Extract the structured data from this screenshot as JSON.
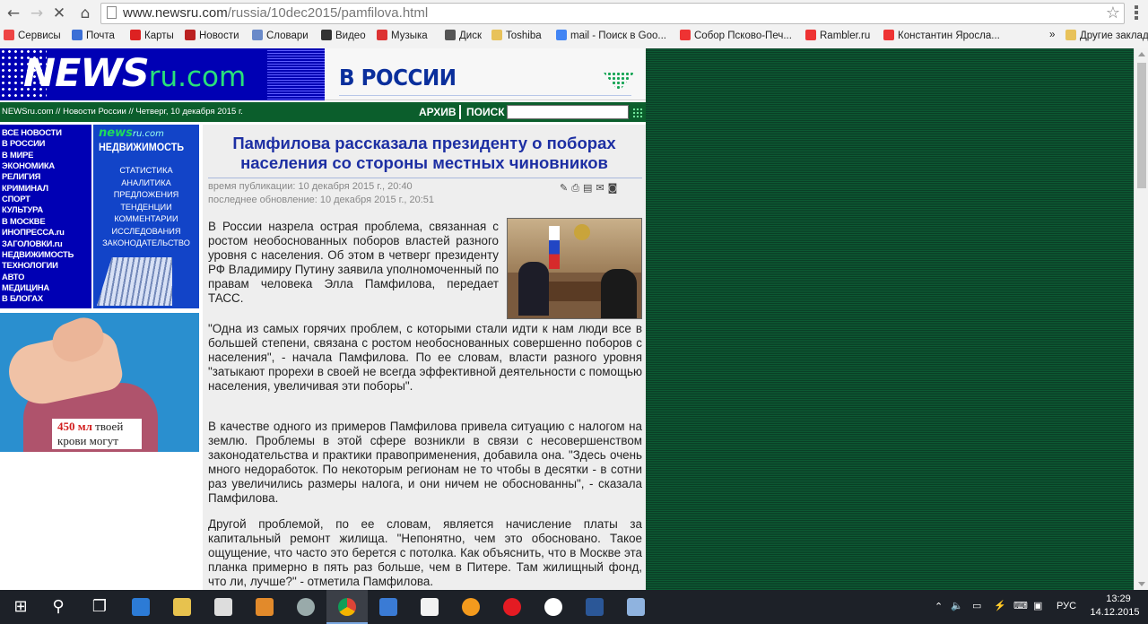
{
  "browser": {
    "url_host": "www.newsru.com",
    "url_path": "/russia/10dec2015/pamfilova.html",
    "bookmarks": [
      {
        "label": "Сервисы",
        "icon": "apps-icon",
        "color": "#e44"
      },
      {
        "label": "Почта",
        "icon": "mail-icon",
        "color": "#3b6fd6"
      },
      {
        "label": "Карты",
        "icon": "map-pin-icon",
        "color": "#d22"
      },
      {
        "label": "Новости",
        "icon": "news-icon",
        "color": "#b22"
      },
      {
        "label": "Словари",
        "icon": "dictionary-icon",
        "color": "#6a8ac9"
      },
      {
        "label": "Видео",
        "icon": "video-icon",
        "color": "#333"
      },
      {
        "label": "Музыка",
        "icon": "music-icon",
        "color": "#d33"
      },
      {
        "label": "Диск",
        "icon": "disk-icon",
        "color": "#555"
      },
      {
        "label": "Toshiba",
        "icon": "folder-icon",
        "color": "#e8c25a"
      },
      {
        "label": "mail - Поиск в Goo...",
        "icon": "google-icon",
        "color": "#4285f4"
      },
      {
        "label": "Собор Псково-Печ...",
        "icon": "yandex-icon",
        "color": "#e33"
      },
      {
        "label": "Rambler.ru",
        "icon": "yandex-icon",
        "color": "#e33"
      },
      {
        "label": "Константин Яросла...",
        "icon": "yandex-icon",
        "color": "#e33"
      },
      {
        "label": "»",
        "icon": "more-icon",
        "color": "#555"
      },
      {
        "label": "Другие закладки",
        "icon": "folder-icon",
        "color": "#e8c25a"
      }
    ]
  },
  "site": {
    "logo_main": "NEWS",
    "logo_domain": "ru.com",
    "section": "В РОССИИ",
    "breadcrumb": "NEWSru.com // Новости России // Четверг, 10 декабря 2015 г.",
    "archive": "АРХИВ",
    "search": "ПОИСК",
    "rubrics": [
      "ВСЕ НОВОСТИ",
      "В РОССИИ",
      "В МИРЕ",
      "ЭКОНОМИКА",
      "РЕЛИГИЯ",
      "КРИМИНАЛ",
      "СПОРТ",
      "КУЛЬТУРА",
      "В МОСКВЕ",
      "ИНОПРЕССА.ru",
      "ЗАГОЛОВКИ.ru",
      "НЕДВИЖИМОСТЬ",
      "ТЕХНОЛОГИИ",
      "АВТО",
      "МЕДИЦИНА",
      "В БЛОГАХ"
    ],
    "nedv_logo": "news",
    "nedv_logo_domain": "ru.com",
    "nedv_title": "НЕДВИЖИМОСТЬ",
    "nedv_items": [
      "СТАТИСТИКА",
      "АНАЛИТИКА",
      "ПРЕДЛОЖЕНИЯ",
      "ТЕНДЕНЦИИ",
      "КОММЕНТАРИИ",
      "ИССЛЕДОВАНИЯ",
      "ЗАКОНОДАТЕЛЬСТВО"
    ],
    "ad_amount": "450 мл",
    "ad_line1": "твоей",
    "ad_line2": "крови могут"
  },
  "article": {
    "title": "Памфилова рассказала президенту о поборах населения со стороны местных чиновников",
    "published": "время публикации: 10 декабря 2015 г., 20:40",
    "updated": "последнее обновление: 10 декабря 2015 г., 20:51",
    "paragraphs": [
      "В России назрела острая проблема, связанная с ростом необоснованных поборов властей разного уровня с населения. Об этом в четверг президенту РФ Владимиру Путину заявила уполномоченный по правам человека Элла Памфилова, передает ТАСС.",
      "\"Одна из самых горячих проблем, с которыми стали идти к нам люди все в большей степени, связана с ростом необоснованных совершенно поборов с населения\", - начала Памфилова. По ее словам, власти разного уровня \"затыкают прорехи в своей не всегда эффективной деятельности с помощью населения, увеличивая эти поборы\".",
      "В качестве одного из примеров Памфилова привела ситуацию с налогом на землю. Проблемы в этой сфере возникли в связи с несовершенством законодательства и практики правоприменения, добавила она. \"Здесь очень много недоработок. По некоторым регионам не то чтобы в десятки - в сотни раз увеличились размеры налога, и они ничем не обоснованны\", - сказала Памфилова.",
      "Другой проблемой, по ее словам, является начисление платы за капитальный ремонт жилища. \"Непонятно, чем это обосновано. Такое ощущение, что часто это берется с потолка. Как объяснить, что в Москве эта планка примерно в пять раз больше, чем в Питере. Там жилищный фонд, что ли, лучше?\" - отметила Памфилова."
    ]
  },
  "taskbar": {
    "lang": "РУС",
    "time": "13:29",
    "date": "14.12.2015"
  }
}
